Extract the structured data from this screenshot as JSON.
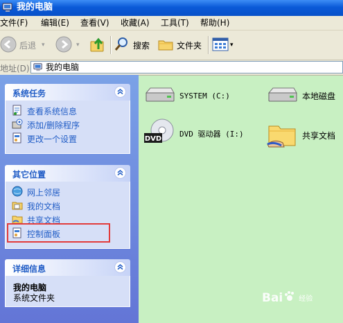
{
  "window": {
    "title": "我的电脑"
  },
  "menu": [
    "文件(F)",
    "编辑(E)",
    "查看(V)",
    "收藏(A)",
    "工具(T)",
    "帮助(H)"
  ],
  "toolbar": {
    "back": "后退",
    "search": "搜索",
    "folders": "文件夹"
  },
  "address": {
    "label": "地址(D)",
    "value": "我的电脑"
  },
  "panels": {
    "tasks": {
      "title": "系统任务",
      "items": [
        "查看系统信息",
        "添加/删除程序",
        "更改一个设置"
      ]
    },
    "places": {
      "title": "其它位置",
      "items": [
        "网上邻居",
        "我的文档",
        "共享文档",
        "控制面板"
      ]
    },
    "details": {
      "title": "详细信息",
      "name": "我的电脑",
      "type": "系统文件夹"
    }
  },
  "content": {
    "items": [
      {
        "label": "SYSTEM (C:)",
        "icon": "hard-drive-icon"
      },
      {
        "label": "本地磁盘",
        "icon": "hard-drive-icon"
      },
      {
        "label": "DVD 驱动器 (I:)",
        "icon": "dvd-drive-icon"
      },
      {
        "label": "共享文档",
        "icon": "shared-folder-icon"
      }
    ]
  },
  "watermark": {
    "brand": "Bai",
    "suffix": "经验"
  },
  "colors": {
    "title_bar": "#0a5ad8",
    "left_pane": "#6f8fe0",
    "link": "#215dc6",
    "highlight": "#e23b3b"
  }
}
